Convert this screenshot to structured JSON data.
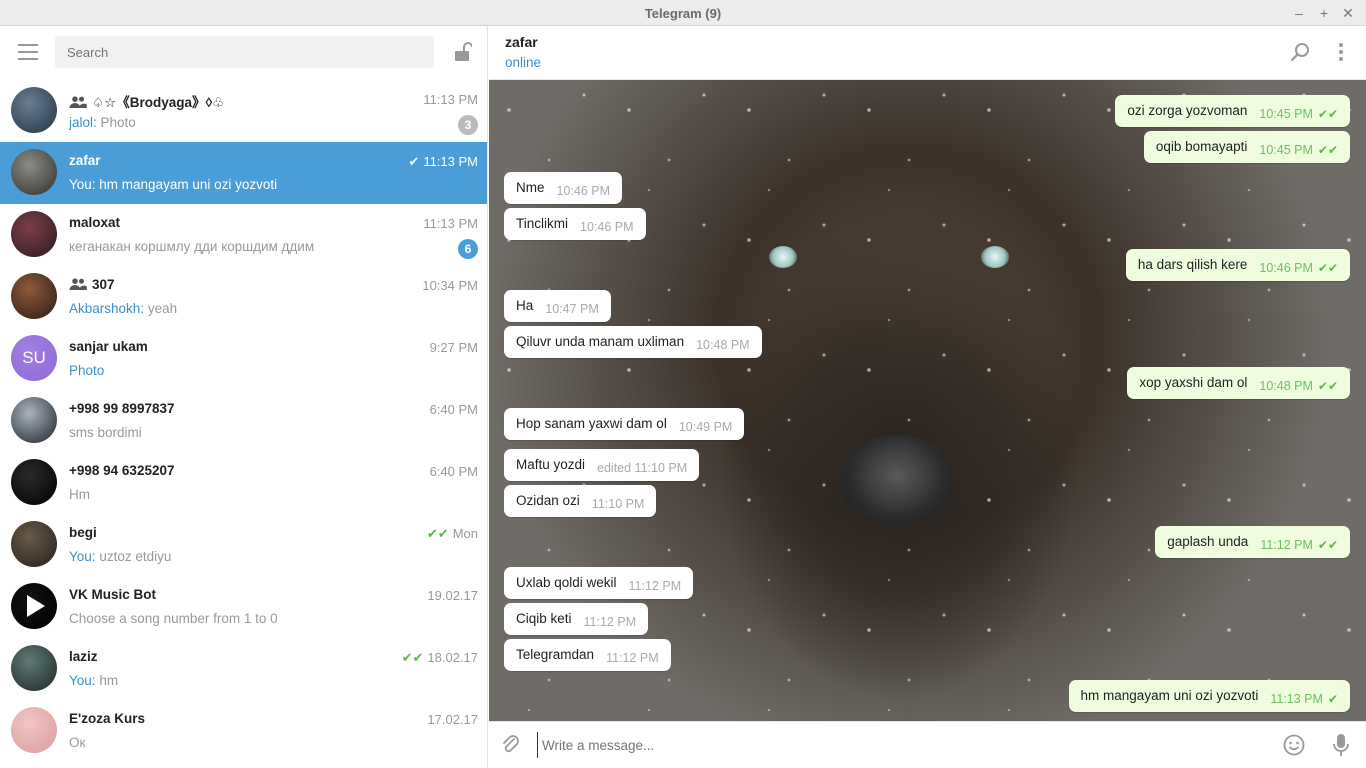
{
  "window": {
    "title": "Telegram (9)"
  },
  "search": {
    "placeholder": "Search"
  },
  "chats": [
    {
      "name": "♤☆《Brodyaga》◊♧",
      "time": "11:13 PM",
      "sender": "jalol:",
      "preview": "Photo",
      "badge": "3",
      "badge_color": "#bbbbbb",
      "group": true,
      "avatar_colors": [
        "#6b7d8e",
        "#233447"
      ]
    },
    {
      "name": "zafar",
      "time": "11:13 PM",
      "sender": "",
      "preview": "You: hm mangayam uni ozi yozvoti",
      "tick": "✔",
      "active": true,
      "avatar_colors": [
        "#8c8c86",
        "#2f2f2b"
      ]
    },
    {
      "name": "maloxat",
      "time": "11:13 PM",
      "sender": "",
      "preview": "кеганакан коршмлу дди коршдим ддим",
      "badge": "6",
      "badge_color": "#4a9dd6",
      "avatar_colors": [
        "#7a3e4a",
        "#2d1a1e"
      ]
    },
    {
      "name": "307",
      "time": "10:34 PM",
      "sender": "Akbarshokh:",
      "preview": "yeah",
      "group": true,
      "avatar_colors": [
        "#8c5a3a",
        "#2c1b12"
      ]
    },
    {
      "name": "sanjar ukam",
      "time": "9:27 PM",
      "sender": "Photo",
      "preview": "",
      "initials": "SU",
      "avatar_colors": [
        "#a07fe0",
        "#8e6ad8"
      ]
    },
    {
      "name": "+998 99 8997837",
      "time": "6:40 PM",
      "sender": "",
      "preview": "sms bordimi",
      "avatar_colors": [
        "#a9b4bd",
        "#1c2127"
      ]
    },
    {
      "name": "+998 94 6325207",
      "time": "6:40 PM",
      "sender": "",
      "preview": "Hm",
      "avatar_colors": [
        "#2a2a2a",
        "#000000"
      ]
    },
    {
      "name": "begi",
      "time": "Mon",
      "sender": "You:",
      "preview": "uztoz etdiyu",
      "tick": "✔✔",
      "tick_green": true,
      "avatar_colors": [
        "#6a5a48",
        "#23201c"
      ]
    },
    {
      "name": "VK Music Bot",
      "time": "19.02.17",
      "sender": "",
      "preview": "Choose a song number from 1 to 0",
      "avatar_colors": [
        "#111111",
        "#000000"
      ],
      "play": true
    },
    {
      "name": "laziz",
      "time": "18.02.17",
      "sender": "You:",
      "preview": "hm",
      "tick": "✔✔",
      "tick_green": true,
      "avatar_colors": [
        "#5f7a76",
        "#1d2826"
      ]
    },
    {
      "name": "E'zoza Kurs",
      "time": "17.02.17",
      "sender": "",
      "preview": "Ок",
      "avatar_colors": [
        "#f2c6c6",
        "#d99b9b"
      ]
    }
  ],
  "conversation": {
    "peer_name": "zafar",
    "peer_status": "online",
    "messages": [
      {
        "dir": "out",
        "text": "ozi zorga yozvoman",
        "time": "10:45 PM",
        "check": "✔✔"
      },
      {
        "dir": "out",
        "text": "oqib bomayapti",
        "time": "10:45 PM",
        "check": "✔✔"
      },
      {
        "dir": "in",
        "text": "Nme",
        "time": "10:46 PM"
      },
      {
        "dir": "in",
        "text": "Tinclikmi",
        "time": "10:46 PM"
      },
      {
        "dir": "out",
        "text": "ha dars qilish kere",
        "time": "10:46 PM",
        "check": "✔✔"
      },
      {
        "dir": "in",
        "text": "Ha",
        "time": "10:47 PM"
      },
      {
        "dir": "in",
        "text": "Qiluvr unda manam uxliman",
        "time": "10:48 PM"
      },
      {
        "dir": "out",
        "text": "xop yaxshi dam ol",
        "time": "10:48 PM",
        "check": "✔✔"
      },
      {
        "dir": "in",
        "text": "Hop sanam yaxwi dam ol",
        "time": "10:49 PM"
      },
      {
        "dir": "in",
        "text": "Maftu yozdi",
        "time": "edited 11:10 PM"
      },
      {
        "dir": "in",
        "text": "Ozidan ozi",
        "time": "11:10 PM"
      },
      {
        "dir": "out",
        "text": "gaplash unda",
        "time": "11:12 PM",
        "check": "✔✔"
      },
      {
        "dir": "in",
        "text": "Uxlab qoldi wekil",
        "time": "11:12 PM"
      },
      {
        "dir": "in",
        "text": "Ciqib keti",
        "time": "11:12 PM"
      },
      {
        "dir": "in",
        "text": "Telegramdan",
        "time": "11:12 PM"
      },
      {
        "dir": "out",
        "text": "hm mangayam uni ozi yozvoti",
        "time": "11:13 PM",
        "check": "✔"
      }
    ]
  },
  "composer": {
    "placeholder": "Write a message..."
  },
  "icons": {
    "menu": "hamburger-icon",
    "lock": "lock-icon",
    "search": "search-icon",
    "more": "more-vertical-icon",
    "attach": "paperclip-icon",
    "emoji": "emoji-icon",
    "mic": "microphone-icon",
    "group": "group-icon"
  },
  "colors": {
    "accent": "#4a9dd6",
    "link": "#3a8fcf",
    "out_bubble": "#effdde",
    "check": "#5eb54a"
  }
}
